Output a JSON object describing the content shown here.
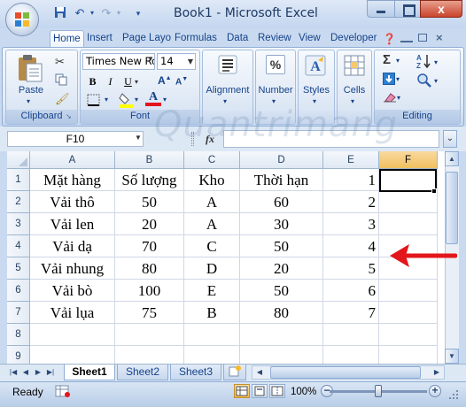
{
  "window": {
    "title": "Book1 - Microsoft Excel",
    "close_label": "x"
  },
  "ribbon_tabs": [
    "Home",
    "Insert",
    "Page Layo",
    "Formulas",
    "Data",
    "Review",
    "View",
    "Developer"
  ],
  "ribbon": {
    "clipboard": {
      "paste_label": "Paste",
      "group_label": "Clipboard"
    },
    "font": {
      "font_name": "Times New Ro",
      "font_size": "14",
      "group_label": "Font",
      "bold": "B",
      "italic": "I",
      "underline": "U",
      "color_letter": "A"
    },
    "alignment": {
      "label": "Alignment"
    },
    "number": {
      "label": "Number",
      "icon_text": "%"
    },
    "styles": {
      "label": "Styles"
    },
    "cells": {
      "label": "Cells"
    },
    "editing": {
      "label": "Editing",
      "sum_symbol": "Σ"
    }
  },
  "formula_bar": {
    "name_box": "F10",
    "fx_label": "fx",
    "formula_value": ""
  },
  "columns": [
    "A",
    "B",
    "C",
    "D",
    "E",
    "F"
  ],
  "selected_column": "F",
  "rows": [
    {
      "num": "1",
      "cells": [
        "Mặt hàng",
        "Số lượng",
        "Kho",
        "Thời hạn",
        "1",
        ""
      ]
    },
    {
      "num": "2",
      "cells": [
        "Vải thô",
        "50",
        "A",
        "60",
        "2",
        ""
      ]
    },
    {
      "num": "3",
      "cells": [
        "Vải len",
        "20",
        "A",
        "30",
        "3",
        ""
      ]
    },
    {
      "num": "4",
      "cells": [
        "Vải dạ",
        "70",
        "C",
        "50",
        "4",
        ""
      ]
    },
    {
      "num": "5",
      "cells": [
        "Vải nhung",
        "80",
        "D",
        "20",
        "5",
        ""
      ]
    },
    {
      "num": "6",
      "cells": [
        "Vải bò",
        "100",
        "E",
        "50",
        "6",
        ""
      ]
    },
    {
      "num": "7",
      "cells": [
        "Vải lụa",
        "75",
        "B",
        "80",
        "7",
        ""
      ]
    },
    {
      "num": "8",
      "cells": [
        "",
        "",
        "",
        "",
        "",
        ""
      ]
    },
    {
      "num": "9",
      "cells": [
        "",
        "",
        "",
        "",
        "",
        ""
      ]
    }
  ],
  "sheet_tabs": [
    "Sheet1",
    "Sheet2",
    "Sheet3"
  ],
  "active_sheet": "Sheet1",
  "status": {
    "text": "Ready",
    "zoom": "100%",
    "zoom_fraction": 0.5
  },
  "watermark": "Quantrimang",
  "colors": {
    "accent": "#15428b",
    "selection_header": "#f1c15f",
    "annotation_arrow": "#e3161b"
  }
}
